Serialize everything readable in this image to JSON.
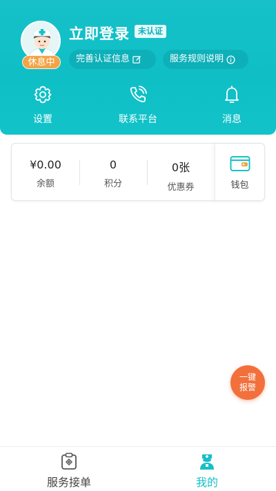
{
  "profile": {
    "login_label": "立即登录",
    "verify_badge": "未认证",
    "status": "休息中",
    "complete_info": "完善认证信息",
    "rules": "服务规则说明"
  },
  "quick_actions": [
    {
      "label": "设置",
      "icon": "gear-icon"
    },
    {
      "label": "联系平台",
      "icon": "phone-icon"
    },
    {
      "label": "消息",
      "icon": "bell-icon"
    }
  ],
  "wallet": {
    "stats": [
      {
        "value": "¥0.00",
        "label": "余额"
      },
      {
        "value": "0",
        "label": "积分"
      },
      {
        "value": "0张",
        "label": "优惠券"
      }
    ],
    "wallet_label": "钱包"
  },
  "sos": {
    "line1": "一键",
    "line2": "报警"
  },
  "tabs": [
    {
      "label": "服务接单",
      "icon": "clipboard-icon",
      "active": false
    },
    {
      "label": "我的",
      "icon": "nurse-icon",
      "active": true
    }
  ],
  "colors": {
    "accent": "#16c1c9",
    "status_orange": "#f2a548",
    "sos_orange": "#f2703c"
  }
}
